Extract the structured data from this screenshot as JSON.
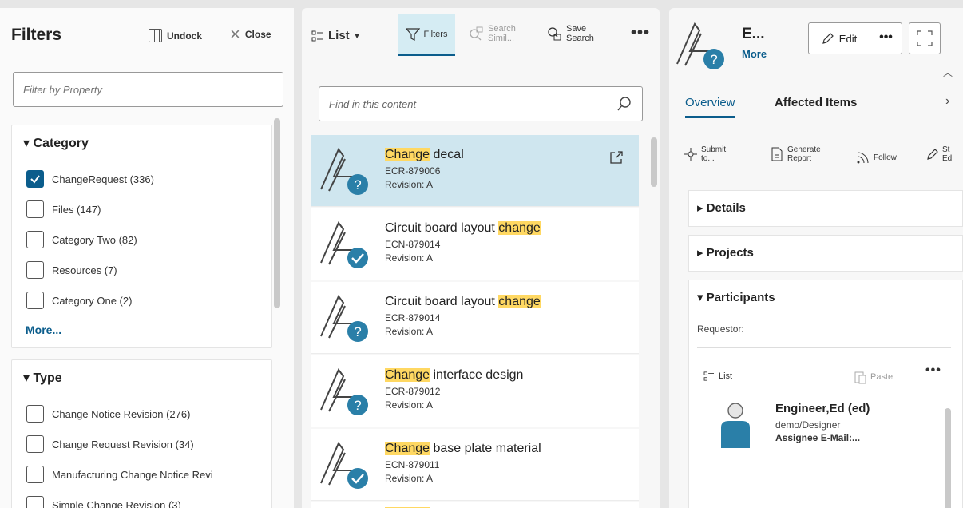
{
  "filters": {
    "title": "Filters",
    "undock_label": "Undock",
    "close_label": "Close",
    "search_placeholder": "Filter by Property",
    "category": {
      "title": "Category",
      "items": [
        {
          "label": "ChangeRequest (336)",
          "checked": true
        },
        {
          "label": "Files (147)",
          "checked": false
        },
        {
          "label": "Category Two (82)",
          "checked": false
        },
        {
          "label": "Resources (7)",
          "checked": false
        },
        {
          "label": "Category One (2)",
          "checked": false
        }
      ],
      "more_label": "More..."
    },
    "type": {
      "title": "Type",
      "items": [
        {
          "label": "Change Notice Revision (276)",
          "checked": false
        },
        {
          "label": "Change Request Revision (34)",
          "checked": false
        },
        {
          "label": "Manufacturing Change Notice Revi",
          "checked": false
        },
        {
          "label": "Simple Change Revision (3)",
          "checked": false
        }
      ]
    }
  },
  "list": {
    "view_label": "List",
    "filters_label": "Filters",
    "search_similar_label": [
      "Search",
      "Simil..."
    ],
    "save_search_label": [
      "Save",
      "Search"
    ],
    "find_placeholder": "Find in this content",
    "items": [
      {
        "pre": "",
        "hl": "Change",
        "post": " decal",
        "number": "ECR-879006",
        "revision": "Revision:  A",
        "status": "question",
        "selected": true
      },
      {
        "pre": "Circuit board layout ",
        "hl": "change",
        "post": "",
        "number": "ECN-879014",
        "revision": "Revision:  A",
        "status": "check",
        "selected": false
      },
      {
        "pre": "Circuit board layout ",
        "hl": "change",
        "post": "",
        "number": "ECR-879014",
        "revision": "Revision:  A",
        "status": "question",
        "selected": false
      },
      {
        "pre": "",
        "hl": "Change",
        "post": " interface design",
        "number": "ECR-879012",
        "revision": "Revision:  A",
        "status": "question",
        "selected": false
      },
      {
        "pre": "",
        "hl": "Change",
        "post": " base plate material",
        "number": "ECN-879011",
        "revision": "Revision:  A",
        "status": "check",
        "selected": false
      }
    ]
  },
  "detail": {
    "title": "E...",
    "more_label": "More",
    "edit_label": "Edit",
    "tabs": [
      "Overview",
      "Affected Items"
    ],
    "actions": {
      "submit": [
        "Submit",
        "to..."
      ],
      "report": [
        "Generate",
        "Report"
      ],
      "follow": "Follow",
      "partial": [
        "St",
        "Ed"
      ]
    },
    "sections": {
      "details": "Details",
      "projects": "Projects",
      "participants": "Participants"
    },
    "requestor_label": "Requestor:",
    "sub_list_label": "List",
    "paste_label": "Paste",
    "person": {
      "name": "Engineer,Ed (ed)",
      "role": "demo/Designer",
      "email_label": "Assignee E-Mail:..."
    }
  },
  "colors": {
    "accent": "#0b5d8c",
    "selected_row": "#cfe6ef",
    "highlight": "#ffd862",
    "status_badge": "#2a7fa8"
  }
}
